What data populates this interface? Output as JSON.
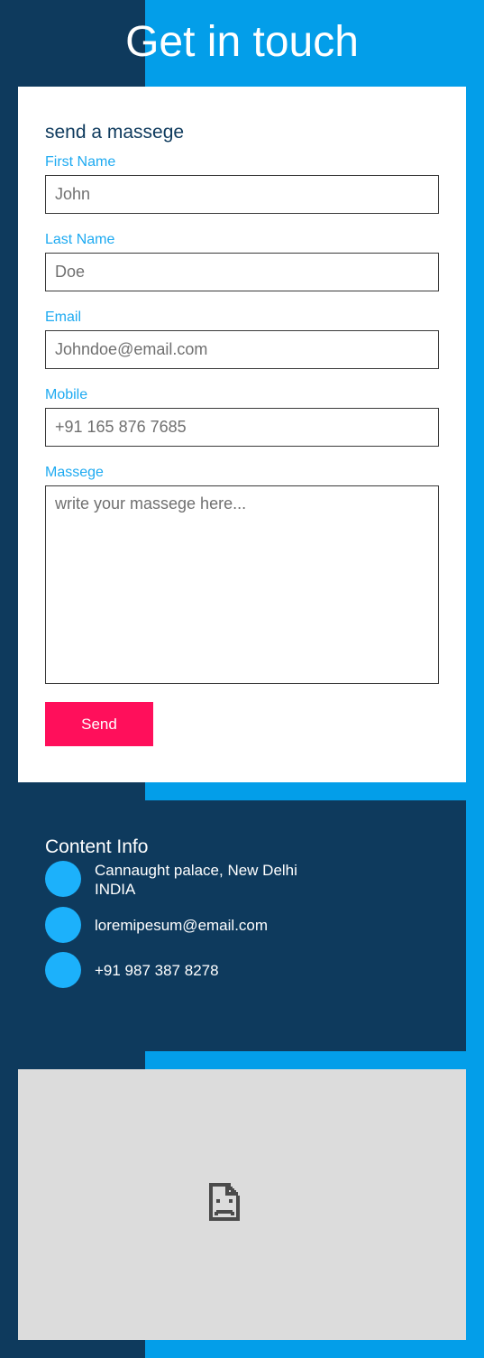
{
  "page": {
    "title": "Get in touch"
  },
  "form": {
    "heading": "send a massege",
    "first_name": {
      "label": "First Name",
      "placeholder": "John"
    },
    "last_name": {
      "label": "Last Name",
      "placeholder": "Doe"
    },
    "email": {
      "label": "Email",
      "placeholder": "Johndoe@email.com"
    },
    "mobile": {
      "label": "Mobile",
      "placeholder": "+91 165 876 7685"
    },
    "message": {
      "label": "Massege",
      "placeholder": "write your massege here..."
    },
    "send_label": "Send"
  },
  "info": {
    "heading": "Content Info",
    "address_line1": "Cannaught palace, New Delhi",
    "address_line2": "INDIA",
    "email": "loremipesum@email.com",
    "phone": "+91 987 387 8278"
  },
  "map": {
    "icon": "broken-image-icon"
  },
  "colors": {
    "dark_navy": "#0e3a5d",
    "bright_blue": "#039ee9",
    "label_blue": "#1eaaf1",
    "circle_blue": "#1cb1fb",
    "send_pink": "#ff0f5b",
    "map_gray": "#dcdcdc"
  }
}
